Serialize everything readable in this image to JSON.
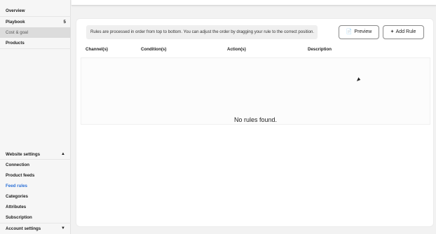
{
  "sidebar": {
    "top_items": [
      {
        "label": "Overview",
        "count": ""
      },
      {
        "label": "Playbook",
        "count": "5"
      },
      {
        "label": "Cost & goal",
        "count": ""
      },
      {
        "label": "Products",
        "count": ""
      }
    ],
    "section_title": "Website settings",
    "items": [
      {
        "label": "Connection"
      },
      {
        "label": "Product feeds"
      },
      {
        "label": "Feed rules"
      },
      {
        "label": "Categories"
      },
      {
        "label": "Attributes"
      },
      {
        "label": "Subscription"
      }
    ],
    "account_section": "Account settings",
    "active_color": "#2a6fd6"
  },
  "rules": {
    "info_text": "Rules are processed in order from top to bottom. You can adjust the order by dragging your rule to the correct position.",
    "preview_label": "Preview",
    "add_rule_label": "Add Rule",
    "columns": [
      "Channel(s)",
      "Condition(s)",
      "Action(s)",
      "Description"
    ],
    "empty_text": "No rules found."
  }
}
